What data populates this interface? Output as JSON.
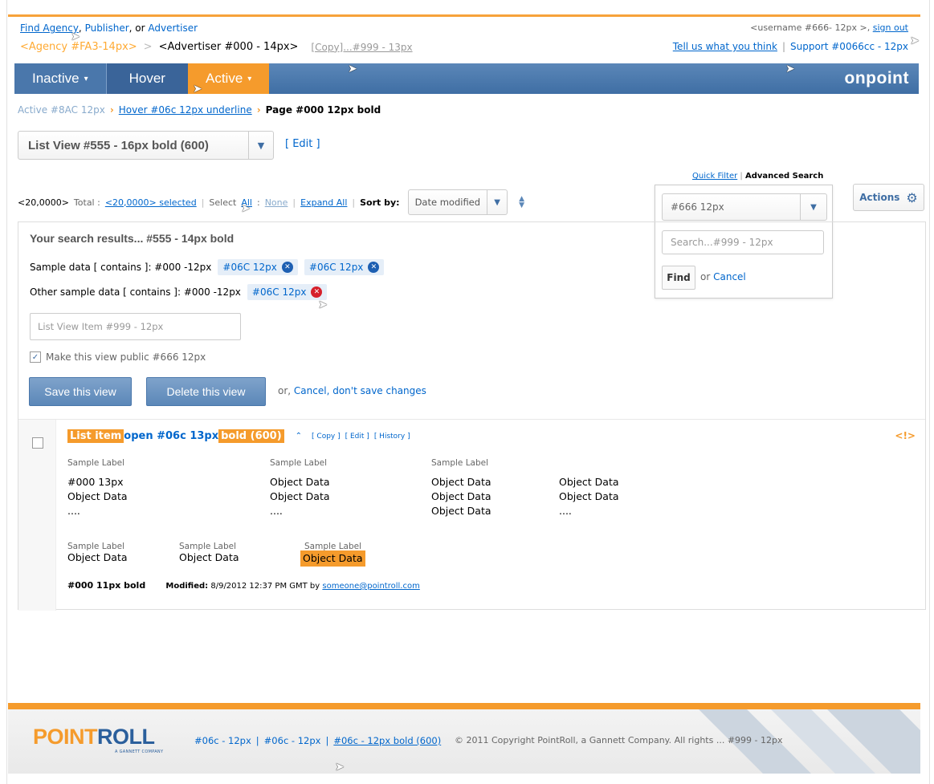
{
  "header": {
    "find_prefix": "Find ",
    "find_agency": "Agency",
    "find_comma": ", ",
    "find_publisher": "Publisher",
    "find_or": ", or ",
    "find_advertiser": "Advertiser",
    "agency": "<Agency #FA3-14px>",
    "crumb_sep": ">",
    "advertiser": "<Advertiser #000 - 14px>",
    "copy": "[Copy]...#999 - 13px",
    "username": "<username #666- 12px >, ",
    "sign_out": "sign out",
    "feedback": "Tell us what you think",
    "separator": "|",
    "support": "Support #0066cc - 12px"
  },
  "nav": {
    "tabs": [
      {
        "label": "Inactive",
        "state": "inactive"
      },
      {
        "label": "Hover",
        "state": "hover"
      },
      {
        "label": "Active",
        "state": "active"
      }
    ],
    "brand": "onpoint"
  },
  "breadcrumb": {
    "active": "Active #8AC 12px",
    "hover": "Hover #06c 12px underline",
    "page": "Page #000 12px bold"
  },
  "list_view": {
    "selected": "List View #555 - 16px bold (600)",
    "edit": "[ Edit ]"
  },
  "toolbar": {
    "total_count": "<20,0000>",
    "total_label": "Total :",
    "selected": "<20,0000> selected",
    "select_label": "Select",
    "all": "All",
    "colon": ":",
    "none": "None",
    "expand_all": "Expand All",
    "sort_by": "Sort by:",
    "sort_value": "Date modified"
  },
  "search_panel": {
    "quick_filter": "Quick Filter",
    "advanced_search": "Advanced Search",
    "select_value": "#666 12px",
    "search_placeholder": "Search...#999 - 12px",
    "find": "Find",
    "or": "or",
    "cancel": "Cancel"
  },
  "actions": {
    "label": "Actions"
  },
  "results": {
    "title": "Your search results... #555 - 14px bold",
    "row1_label": "Sample data [ contains ]: #000 -12px",
    "row1_chips": [
      "#06C 12px",
      "#06C 12px"
    ],
    "row2_label": "Other sample data [ contains ]: #000 -12px",
    "row2_chips": [
      "#06C 12px"
    ],
    "list_item_placeholder": "List View Item #999 - 12px",
    "public_label": "Make this view public #666 12px",
    "save": "Save this view",
    "delete": "Delete this view",
    "or": "or,",
    "cancel": "Cancel, don't save changes"
  },
  "list_item": {
    "hl1": "List item",
    "open": "open #06c 13px",
    "hl2": "bold (600)",
    "caret": "^",
    "copy": "[ Copy ]",
    "edit": "[ Edit ]",
    "history": "[ History ]",
    "alert": "<!>",
    "label": "Sample Label",
    "col1": [
      "#000 13px",
      "Object Data",
      "...."
    ],
    "col2": [
      "Object Data",
      "Object Data",
      "...."
    ],
    "col3": [
      "Object Data",
      "Object Data",
      "Object Data"
    ],
    "col4": [
      "Object Data",
      "Object Data",
      "...."
    ],
    "bottom": [
      "Object Data",
      "Object Data",
      "Object Data"
    ],
    "meta_bold": "#000 11px bold",
    "modified_label": "Modified:",
    "modified_value": "8/9/2012 12:37 PM GMT by",
    "modified_by": "someone@pointroll.com"
  },
  "footer": {
    "logo_point": "POINT",
    "logo_roll": "ROLL",
    "logo_sub": "A GANNETT COMPANY",
    "link1": "#06c - 12px",
    "link2": "#06c - 12px",
    "link3": "#06c - 12px bold (600)",
    "separator": "|",
    "copyright": "© 2011 Copyright PointRoll, a Gannett Company.  All rights ... #999 - 12px"
  }
}
